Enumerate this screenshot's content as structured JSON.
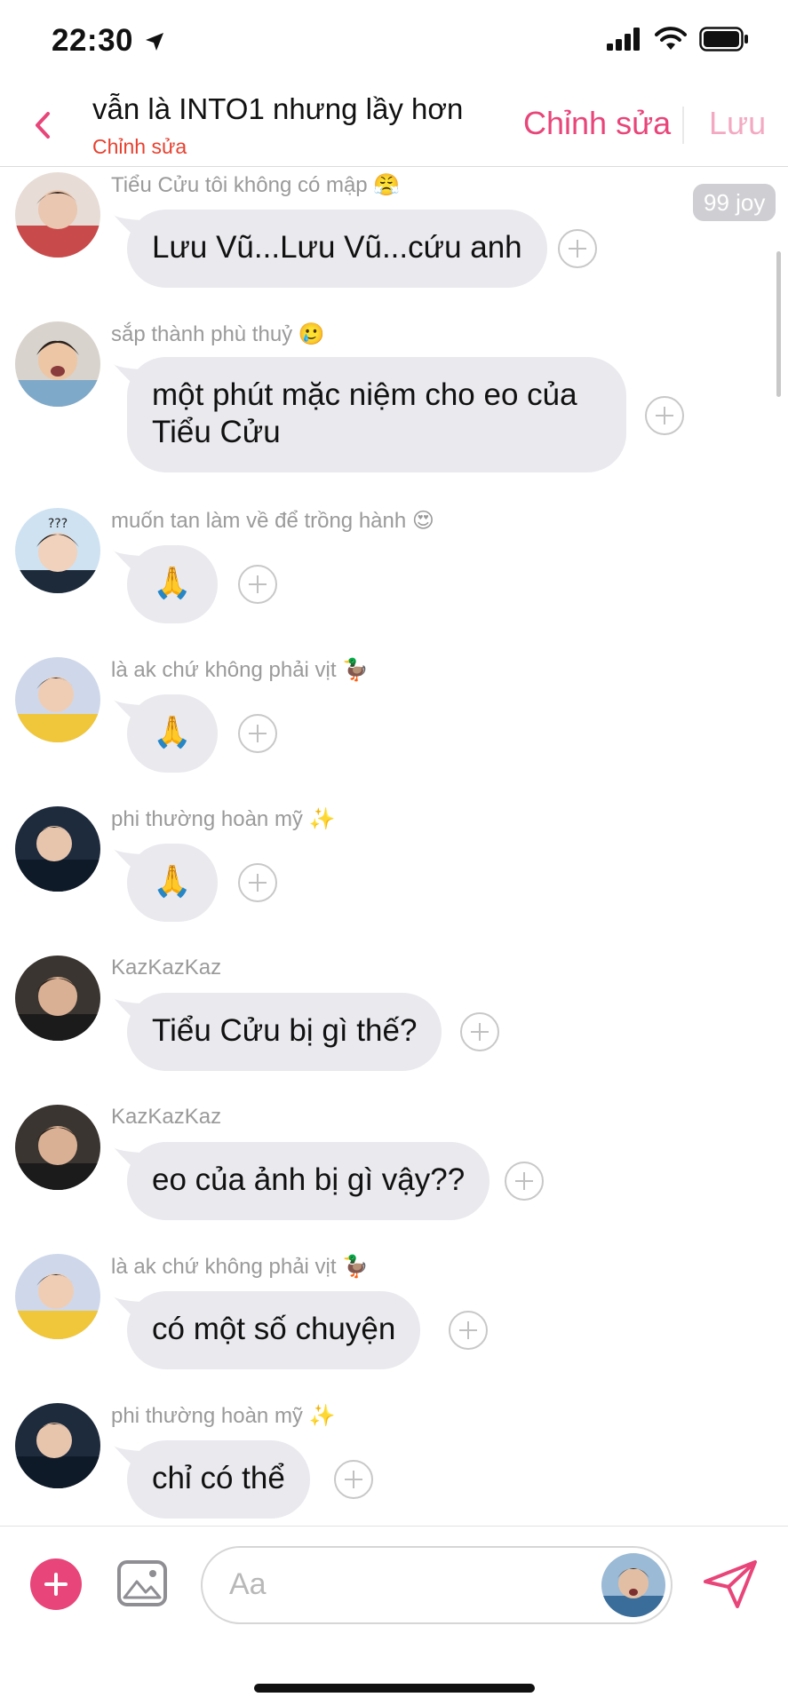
{
  "status_bar": {
    "time": "22:30"
  },
  "header": {
    "title": "vẫn là INTO1 nhưng lầy hơn",
    "subtitle": "Chỉnh sửa",
    "edit_label": "Chỉnh sửa",
    "save_label": "Lưu"
  },
  "badge": "99 joy",
  "messages": [
    {
      "sender": "Tiểu Cửu tôi không có mập 😤",
      "text": "Lưu Vũ...Lưu Vũ...cứu anh"
    },
    {
      "sender": "sắp thành phù thuỷ 🥲",
      "text_line1": "một phút mặc niệm cho eo của",
      "text_line2": "Tiểu Cửu"
    },
    {
      "sender": "muốn tan làm về để trồng hành 😍",
      "text": "🙏"
    },
    {
      "sender": "là ak chứ không phải vịt 🦆",
      "text": "🙏"
    },
    {
      "sender": "phi thường hoàn mỹ ✨",
      "text": "🙏"
    },
    {
      "sender": "KazKazKaz",
      "text": "Tiểu Cửu bị gì thế?"
    },
    {
      "sender": "KazKazKaz",
      "text": "eo của ảnh bị gì vậy??"
    },
    {
      "sender": "là ak chứ không phải vịt 🦆",
      "text": "có một số chuyện"
    },
    {
      "sender": "phi thường hoàn mỹ ✨",
      "text": "chỉ có thể"
    }
  ],
  "composer": {
    "placeholder": "Aa"
  },
  "colors": {
    "accent": "#e8457a",
    "subtitle": "#e8402f",
    "bubble": "#e9e9ee"
  },
  "icons": [
    "location-arrow-icon",
    "signal-icon",
    "wifi-icon",
    "battery-icon",
    "back-chevron-icon",
    "add-reaction-icon",
    "plus-icon",
    "image-icon",
    "send-icon"
  ]
}
